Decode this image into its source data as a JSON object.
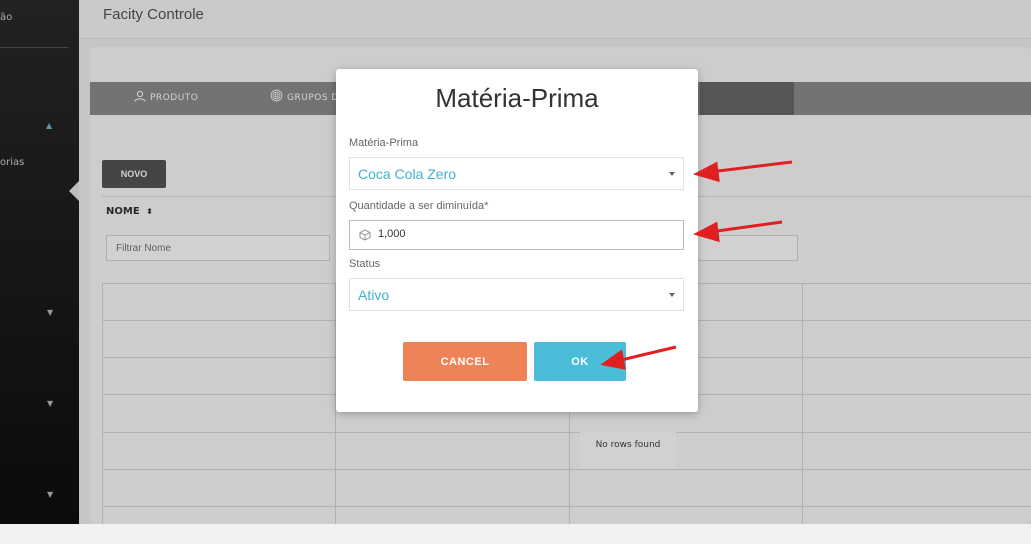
{
  "app": {
    "title": "Facity Controle"
  },
  "sidebar": {
    "items": [
      {
        "label": "ão"
      },
      {
        "label": "orias"
      }
    ]
  },
  "tabs": [
    {
      "label": "PRODUTO",
      "icon": "user-icon"
    },
    {
      "label": "GRUPOS D",
      "icon": "fingerprint-icon"
    }
  ],
  "toolbar": {
    "new_label": "NOVO"
  },
  "table": {
    "columns": [
      {
        "label": "NOME"
      }
    ],
    "filter_placeholder": "Filtrar Nome",
    "empty_text": "No rows found"
  },
  "modal": {
    "title": "Matéria-Prima",
    "material": {
      "label": "Matéria-Prima",
      "value": "Coca Cola Zero"
    },
    "quantity": {
      "label": "Quantidade a ser diminuída*",
      "value": "1,000"
    },
    "status": {
      "label": "Status",
      "value": "Ativo"
    },
    "cancel_label": "CANCEL",
    "ok_label": "OK"
  },
  "colors": {
    "accent": "#4cbdd8",
    "cancel": "#ee8357",
    "select_text": "#3fb2cf",
    "annotation_arrow": "#e02020"
  }
}
